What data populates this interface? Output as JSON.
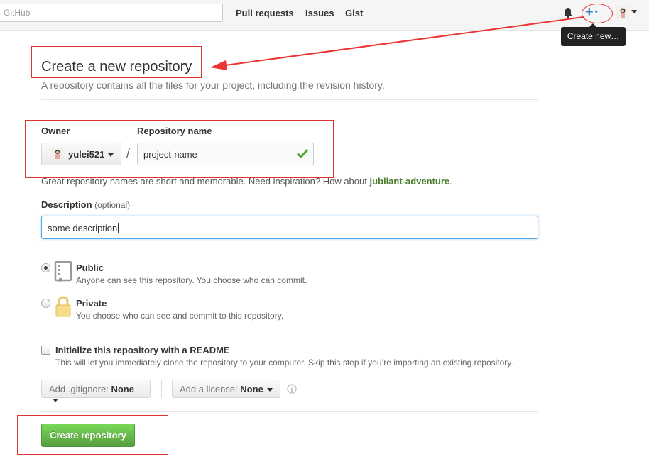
{
  "header": {
    "search_placeholder": "GitHub",
    "nav": [
      "Pull requests",
      "Issues",
      "Gist"
    ],
    "plus_label": "+",
    "tooltip": "Create new…"
  },
  "page": {
    "title": "Create a new repository",
    "subtitle": "A repository contains all the files for your project, including the revision history."
  },
  "owner": {
    "label": "Owner",
    "value": "yulei521"
  },
  "repo": {
    "label": "Repository name",
    "separator": "/",
    "value": "project-name"
  },
  "hint": {
    "text": "Great repository names are short and memorable. Need inspiration? How about ",
    "suggestion": "jubilant-adventure",
    "end": "."
  },
  "description": {
    "label": "Description",
    "optional": "(optional)",
    "value": "some description"
  },
  "visibility": {
    "public_title": "Public",
    "public_desc": "Anyone can see this repository. You choose who can commit.",
    "private_title": "Private",
    "private_desc": "You choose who can see and commit to this repository.",
    "selected": "Public"
  },
  "init": {
    "title": "Initialize this repository with a README",
    "desc": "This will let you immediately clone the repository to your computer. Skip this step if you’re importing an existing repository.",
    "checked": false
  },
  "gitignore": {
    "label": "Add .gitignore:",
    "value": "None"
  },
  "license": {
    "label": "Add a license:",
    "value": "None"
  },
  "create_button": "Create repository",
  "colors": {
    "accent_green": "#6cc644",
    "link_blue": "#4183c4",
    "annotation_red": "#dd3333"
  }
}
